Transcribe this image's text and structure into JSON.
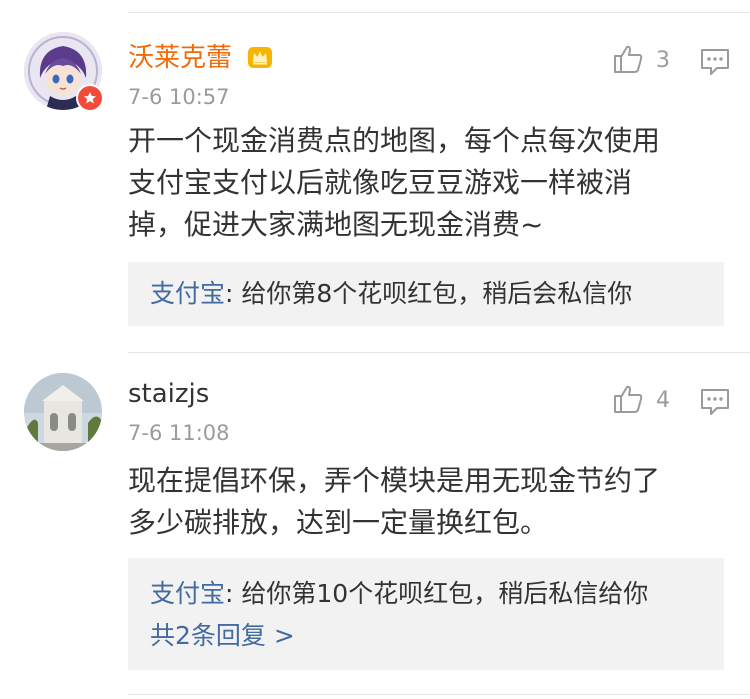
{
  "comments": [
    {
      "username": "沃莱克蕾",
      "time": "7-6 10:57",
      "likes": "3",
      "body_lines": [
        "开一个现金消费点的地图，每个点每次使用",
        "支付宝支付以后就像吃豆豆游戏一样被消",
        "掉，促进大家满地图无现金消费~"
      ],
      "reply": {
        "author": "支付宝",
        "separator": ": ",
        "text": "给你第8个花呗红包，稍后会私信你"
      },
      "badges": [
        "vip-crown-icon",
        "verified-badge-icon"
      ]
    },
    {
      "username": "staizjs",
      "time": "7-6 11:08",
      "likes": "4",
      "body_lines": [
        "现在提倡环保，弄个模块是用无现金节约了",
        "多少碳排放，达到一定量换红包。"
      ],
      "reply": {
        "author": "支付宝",
        "separator": ": ",
        "text": "给你第10个花呗红包，稍后私信给你",
        "more": "共2条回复 >"
      }
    }
  ],
  "colors": {
    "username_highlight": "#f26b0b",
    "reply_author": "#436ba1",
    "meta_gray": "#9b9b9b",
    "reply_bg": "#f2f2f2"
  }
}
